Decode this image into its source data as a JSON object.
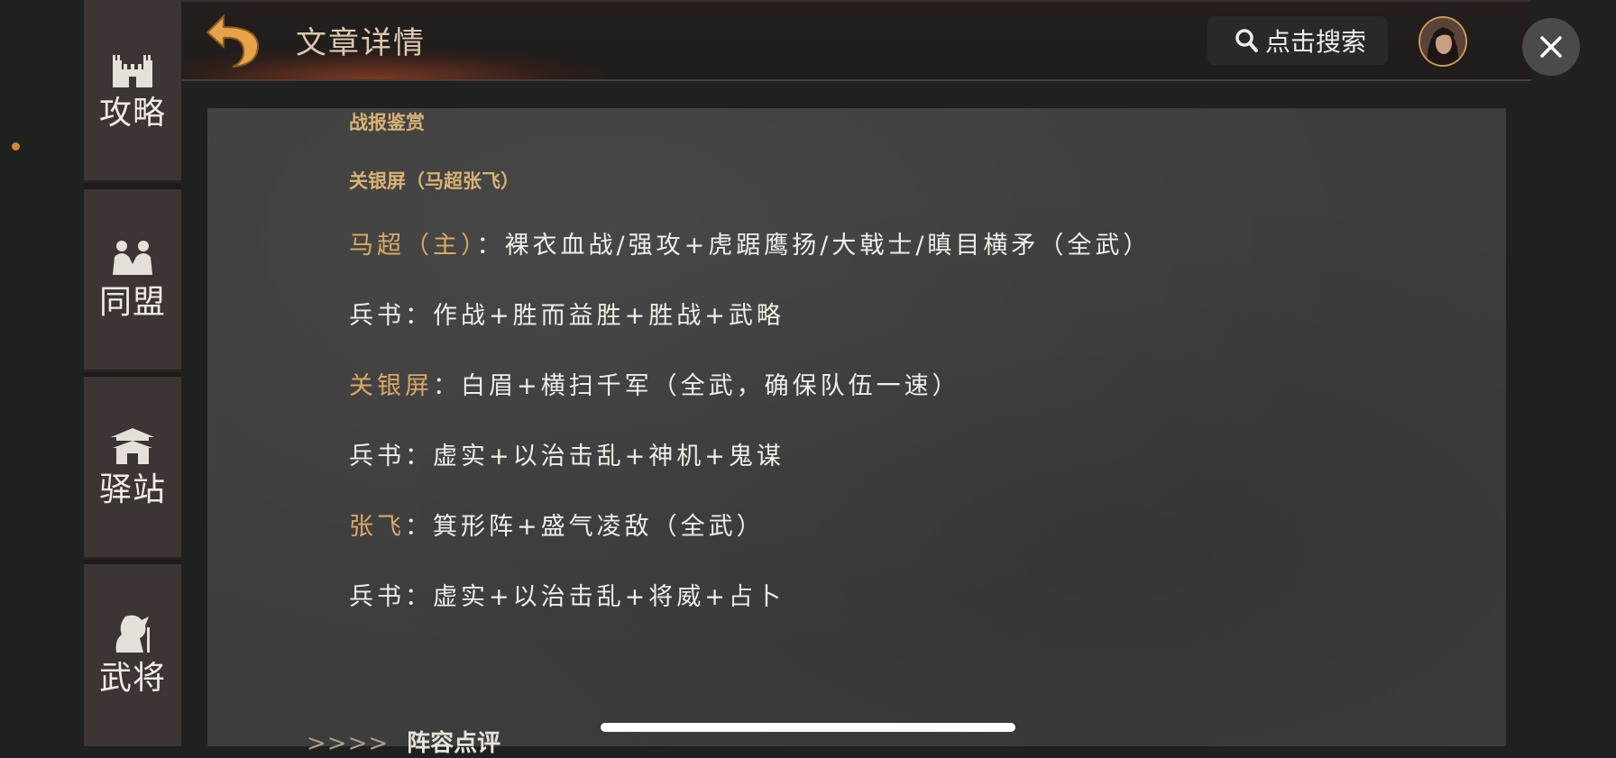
{
  "sidebar": {
    "items": [
      {
        "label": "攻略",
        "icon": "castle-icon"
      },
      {
        "label": "同盟",
        "icon": "alliance-icon"
      },
      {
        "label": "驿站",
        "icon": "post-station-icon"
      },
      {
        "label": "武将",
        "icon": "general-icon"
      }
    ]
  },
  "header": {
    "title": "文章详情",
    "search_label": "点击搜索"
  },
  "article": {
    "category": "战报鉴赏",
    "lineup_title": "关银屏（马超张飞）",
    "lines": [
      {
        "name": "马超（主）",
        "text": "：裸衣血战/强攻+虎踞鹰扬/大戟士/瞋目横矛（全武）"
      },
      {
        "name": "",
        "text": "兵书：作战+胜而益胜+胜战+武略"
      },
      {
        "name": "关银屏",
        "text": "：白眉+横扫千军（全武，确保队伍一速）"
      },
      {
        "name": "",
        "text": "兵书：虚实+以治击乱+神机+鬼谋"
      },
      {
        "name": "张飞",
        "text": "：箕形阵+盛气凌敌（全武）"
      },
      {
        "name": "",
        "text": "兵书：虚实+以治击乱+将威+占卜"
      }
    ],
    "next_section_arrows": ">>>>",
    "next_section_title": "阵容点评"
  },
  "colors": {
    "accent": "#d9a866",
    "section_title": "#d8b273",
    "indicator_dot": "#d08a2e"
  }
}
